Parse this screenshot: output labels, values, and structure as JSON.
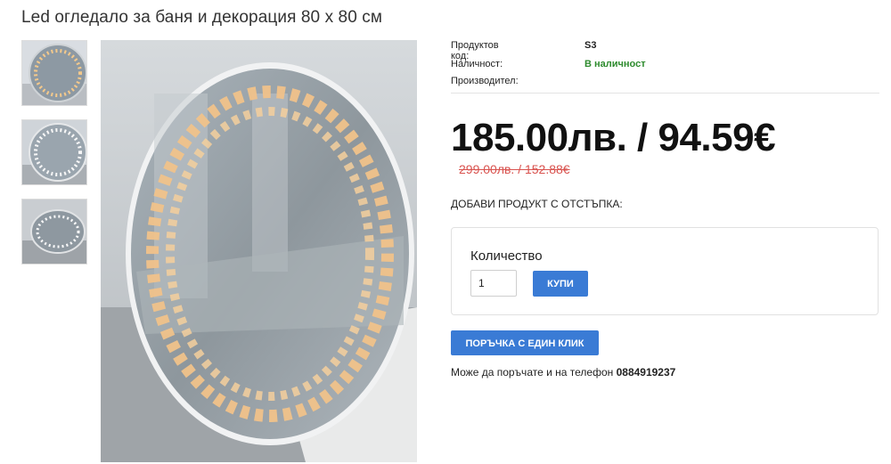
{
  "product": {
    "title": "Led огледало за баня и декорация 80 х 80 см"
  },
  "details": {
    "code_label": "Продуктов код:",
    "code_value": "S3",
    "availability_label": "Наличност:",
    "availability_value": "В наличност",
    "manufacturer_label": "Производител:",
    "manufacturer_value": ""
  },
  "pricing": {
    "price": "185.00лв. / 94.59€",
    "old_price": "299.00лв. / 152.88€"
  },
  "addon_label": "ДОБАВИ ПРОДУКТ С ОТСТЪПКА:",
  "quantity": {
    "label": "Количество",
    "value": "1",
    "buy_label": "КУПИ"
  },
  "one_click": {
    "label": "ПОРЪЧКА С ЕДИН КЛИК"
  },
  "phone": {
    "text": "Може да поръчате и на телефон",
    "number": "0884919237"
  },
  "colors": {
    "accent": "#3a7bd5",
    "in_stock": "#2e8b2e",
    "old_price": "#d9534f"
  },
  "images": {
    "thumbnails": [
      "mirror-thumb-lit",
      "mirror-thumb-off",
      "mirror-thumb-side"
    ],
    "main": "round-led-mirror-photo"
  }
}
